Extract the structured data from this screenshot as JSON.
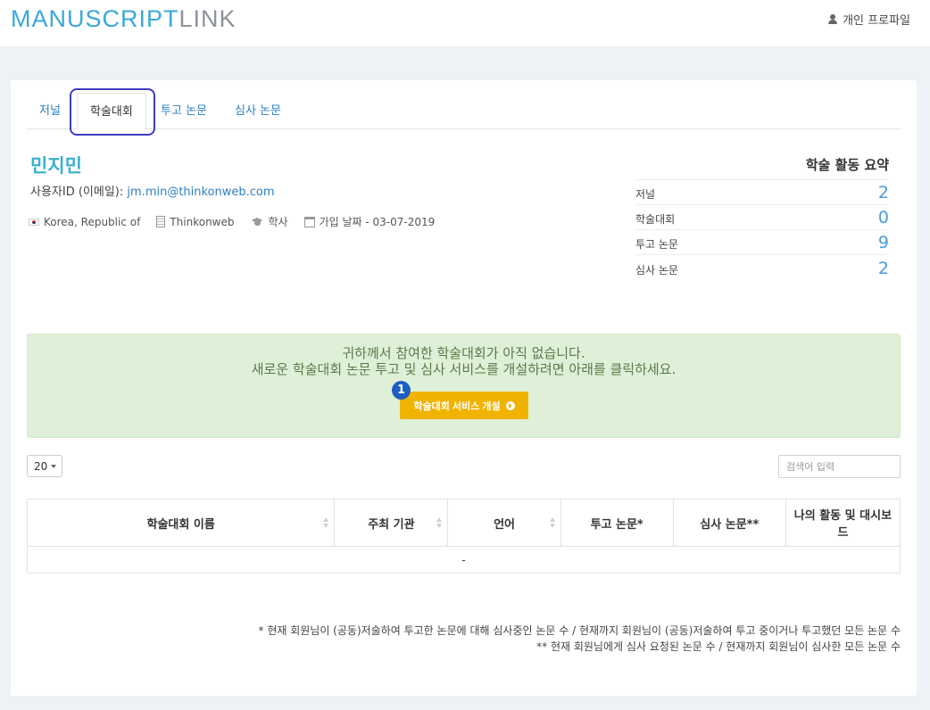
{
  "header": {
    "logo_part1": "MANUSCRIPT",
    "logo_part2": "LINK",
    "profile_label": "개인 프로파일"
  },
  "tabs": [
    {
      "label": "저널",
      "active": false
    },
    {
      "label": "학술대회",
      "active": true
    },
    {
      "label": "투고 논문",
      "active": false
    },
    {
      "label": "심사 논문",
      "active": false
    }
  ],
  "user": {
    "name": "민지민",
    "id_label": "사용자ID (이메일):",
    "email": "jm.min@thinkonweb.com",
    "country": "Korea, Republic of",
    "organization": "Thinkonweb",
    "degree": "학사",
    "join_label": "가입 날짜 - 03-07-2019"
  },
  "summary": {
    "title": "학술 활동 요약",
    "rows": [
      {
        "label": "저널",
        "value": "2"
      },
      {
        "label": "학술대회",
        "value": "0"
      },
      {
        "label": "투고 논문",
        "value": "9"
      },
      {
        "label": "심사 논문",
        "value": "2"
      }
    ]
  },
  "notice": {
    "line1": "귀하께서 참여한 학술대회가 아직 없습니다.",
    "line2": "새로운 학술대회 논문 투고 및 심사 서비스를 개설하려면 아래를 클릭하세요.",
    "button_label": "학술대회 서비스 개설",
    "step_badge": "1"
  },
  "controls": {
    "page_size": "20",
    "search_placeholder": "검색어 입력"
  },
  "table": {
    "columns": [
      "학술대회 이름",
      "주최 기관",
      "언어",
      "투고 논문*",
      "심사 논문**",
      "나의 활동 및 대시보드"
    ],
    "empty_text": "-"
  },
  "footnotes": {
    "f1": "* 현재 회원님이 (공동)저술하여 투고한 논문에 대해 심사중인 논문 수 / 현재까지 회원님이 (공동)저술하여 투고 중이거나 투고했던 모든 논문 수",
    "f2": "** 현재 회원님에게 심사 요청된 논문 수 / 현재까지 회원님이 심사한 모든 논문 수"
  },
  "colors": {
    "accent": "#3aa8d8",
    "button": "#f0b400",
    "notice_bg": "#dff0d8",
    "highlight": "#3c3cc0"
  }
}
